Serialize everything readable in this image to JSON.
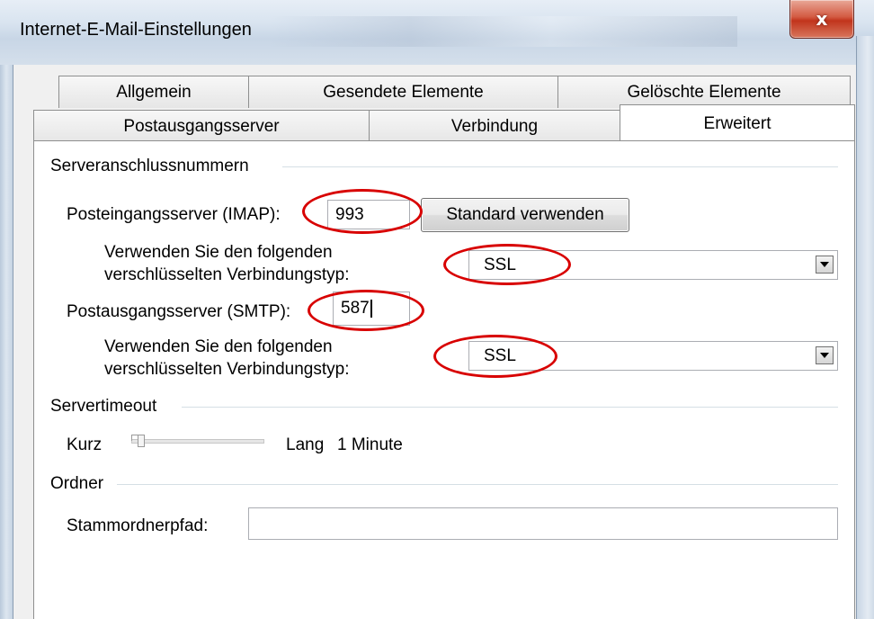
{
  "window": {
    "title": "Internet-E-Mail-Einstellungen",
    "close_glyph": "x"
  },
  "tabs": {
    "row1": [
      "Allgemein",
      "Gesendete Elemente",
      "Gelöschte Elemente"
    ],
    "row2": [
      "Postausgangsserver",
      "Verbindung",
      "Erweitert"
    ],
    "active": "Erweitert"
  },
  "ports": {
    "group_label": "Serveranschlussnummern",
    "imap_label": "Posteingangsserver (IMAP):",
    "imap_value": "993",
    "standard_button": "Standard verwenden",
    "enc1_label_line1": "Verwenden Sie den folgenden",
    "enc1_label_line2": "verschlüsselten Verbindungstyp:",
    "enc1_value": "SSL",
    "smtp_label": "Postausgangsserver (SMTP):",
    "smtp_value": "587",
    "enc2_label_line1": "Verwenden Sie den folgenden",
    "enc2_label_line2": "verschlüsselten Verbindungstyp:",
    "enc2_value": "SSL"
  },
  "timeout": {
    "group_label": "Servertimeout",
    "short_label": "Kurz",
    "long_label": "Lang",
    "value_text": "1 Minute",
    "slider_level_percent": 5
  },
  "folders": {
    "group_label": "Ordner",
    "root_label": "Stammordnerpfad:",
    "root_value": ""
  },
  "annotations": {
    "highlight_color": "#d80000"
  }
}
